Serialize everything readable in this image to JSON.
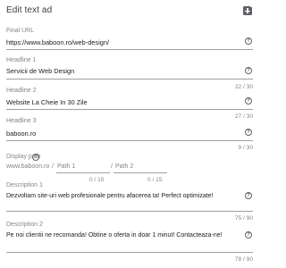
{
  "header": {
    "title": "Edit text ad"
  },
  "final_url": {
    "label": "Final URL",
    "value": "https://www.baboon.ro/web-design/"
  },
  "headline1": {
    "label": "Headline 1",
    "value": "Servicii de Web Design",
    "count": "22 / 30"
  },
  "headline2": {
    "label": "Headline 2",
    "value": "Website La Cheie In 30 Zile",
    "count": "27 / 30"
  },
  "headline3": {
    "label": "Headline 3",
    "value": "baboon.ro",
    "count": "9 / 30"
  },
  "display_path": {
    "label": "Display path",
    "domain": "www.baboon.ro",
    "path1_placeholder": "Path 1",
    "path2_placeholder": "Path 2",
    "path1_count": "0 / 15",
    "path2_count": "0 / 15"
  },
  "description1": {
    "label": "Description 1",
    "value": "Dezvoltam site-uri web profesionale pentru afacerea ta! Perfect optimizate!",
    "count": "75 / 90"
  },
  "description2": {
    "label": "Description 2",
    "value": "Pe noi clientii ne recomanda! Obtine o oferta in doar 1 minut! Contacteaza-ne!",
    "count": "78 / 90"
  },
  "help_glyph": "?"
}
